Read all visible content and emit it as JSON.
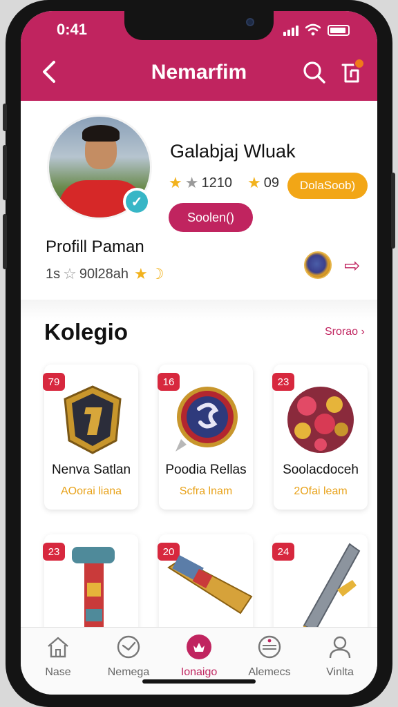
{
  "status": {
    "time": "0:41"
  },
  "header": {
    "title": "Nemarfim"
  },
  "profile": {
    "username": "Galabjaj Wluak",
    "rating_text": "1210",
    "rating_count": "09",
    "gold_button": "DolaSoob)",
    "pink_button": "Soolen()",
    "name": "Profill Paman",
    "stats_prefix": "1s",
    "stats_text": "90l28ah"
  },
  "collection": {
    "title": "Kolegio",
    "see_all": "Srorao",
    "items": [
      {
        "badge": "79",
        "name": "Nenva Satlan",
        "sub": "AOorai liana"
      },
      {
        "badge": "16",
        "name": "Poodia Rellas",
        "sub": "Scfra lnam"
      },
      {
        "badge": "23",
        "name": "Soolacdoceh",
        "sub": "2Ofai leam"
      }
    ],
    "items_row2": [
      {
        "badge": "23"
      },
      {
        "badge": "20"
      },
      {
        "badge": "24"
      }
    ]
  },
  "tabs": [
    {
      "label": "Nase",
      "icon": "home-icon"
    },
    {
      "label": "Nemega",
      "icon": "compass-icon"
    },
    {
      "label": "Ionaigo",
      "icon": "collection-icon",
      "active": true
    },
    {
      "label": "Alemecs",
      "icon": "ball-icon"
    },
    {
      "label": "Vinlta",
      "icon": "profile-icon"
    }
  ],
  "colors": {
    "brand": "#c0245f",
    "gold": "#f2a616",
    "badge": "#d7283e",
    "verified": "#37b6c6"
  }
}
